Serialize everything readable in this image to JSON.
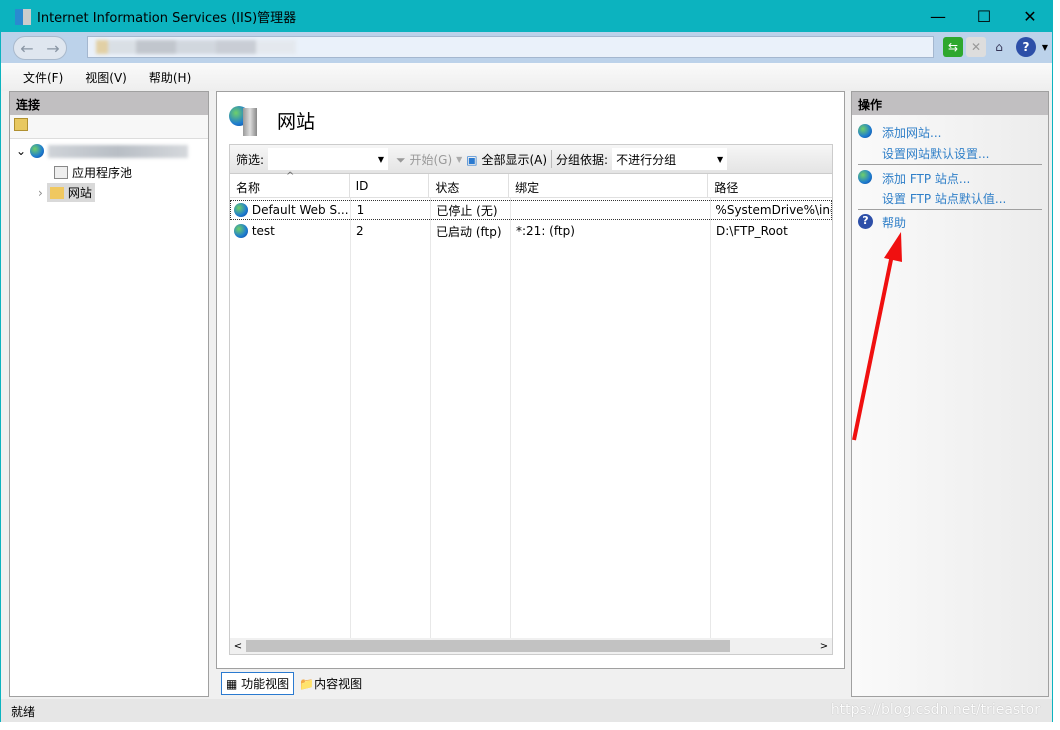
{
  "window": {
    "title": "Internet Information Services (IIS)管理器"
  },
  "menu": {
    "items": [
      "文件(F)",
      "视图(V)",
      "帮助(H)"
    ]
  },
  "connections": {
    "header": "连接",
    "tree": {
      "app_pools": "应用程序池",
      "sites": "网站"
    }
  },
  "main": {
    "title": "网站",
    "filter": {
      "label": "筛选:",
      "value": "",
      "start": "开始(G)",
      "show_all": "全部显示(A)",
      "group_label": "分组依据:",
      "group_value": "不进行分组"
    },
    "columns": [
      "名称",
      "ID",
      "状态",
      "绑定",
      "路径"
    ],
    "rows": [
      {
        "name": "Default Web S...",
        "id": "1",
        "status": "已停止 (无)",
        "binding": "",
        "path": "%SystemDrive%\\inetpub"
      },
      {
        "name": "test",
        "id": "2",
        "status": "已启动 (ftp)",
        "binding": "*:21: (ftp)",
        "path": "D:\\FTP_Root"
      }
    ],
    "tabs": {
      "features": "功能视图",
      "content": "内容视图"
    }
  },
  "actions": {
    "header": "操作",
    "add_site": "添加网站...",
    "site_defaults": "设置网站默认设置...",
    "add_ftp": "添加 FTP 站点...",
    "ftp_defaults": "设置 FTP 站点默认值...",
    "help": "帮助"
  },
  "status": {
    "text": "就绪",
    "watermark": "https://blog.csdn.net/trieastor"
  },
  "colors": {
    "titlebar": "#0cb3bf",
    "link": "#2f7fc8",
    "arrow": "#f01010"
  }
}
